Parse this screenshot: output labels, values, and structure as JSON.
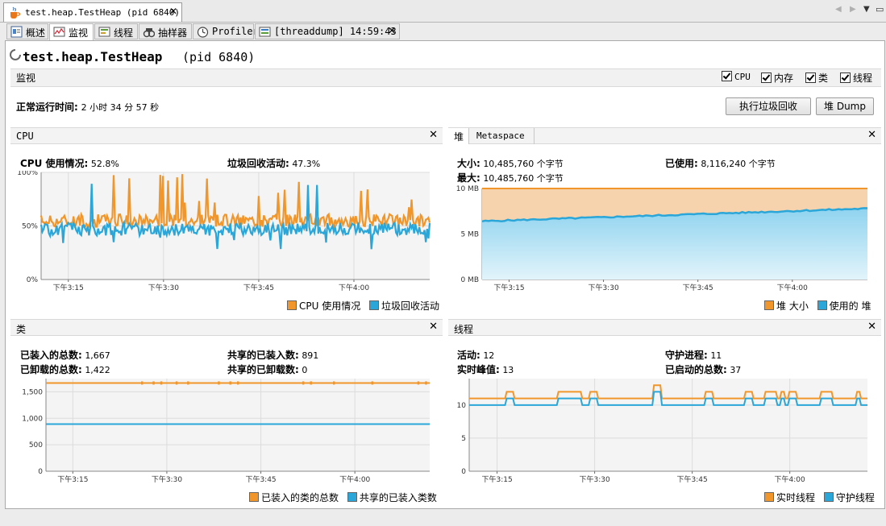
{
  "window": {
    "tab_title": "test.heap.TestHeap (pid 6840)"
  },
  "subtabs": [
    {
      "label": "概述",
      "icon": "overview-icon"
    },
    {
      "label": "监视",
      "icon": "monitor-icon"
    },
    {
      "label": "线程",
      "icon": "threads-icon"
    },
    {
      "label": "抽样器",
      "icon": "sampler-icon"
    },
    {
      "label": "Profiler",
      "icon": "profiler-icon"
    },
    {
      "label": "[threaddump] 14:59:43",
      "icon": "threaddump-icon"
    }
  ],
  "app": {
    "name": "test.heap.TestHeap",
    "pid": "(pid 6840)"
  },
  "monitor": {
    "label": "监视",
    "checkboxes": [
      {
        "label": "CPU",
        "checked": true
      },
      {
        "label": "内存",
        "checked": true
      },
      {
        "label": "类",
        "checked": true
      },
      {
        "label": "线程",
        "checked": true
      }
    ],
    "uptime_label": "正常运行时间:",
    "uptime_value": "2 小时 34 分 57 秒",
    "gc_button": "执行垃圾回收",
    "heapdump_button": "堆 Dump"
  },
  "cpu": {
    "title": "CPU",
    "usage_label": "CPU 使用情况:",
    "usage_value": "52.8%",
    "gc_label": "垃圾回收活动:",
    "gc_value": "47.3%",
    "legend": [
      "CPU 使用情况",
      "垃圾回收活动"
    ]
  },
  "heap": {
    "tabs": [
      "堆",
      "Metaspace"
    ],
    "size_label": "大小:",
    "size_value": "10,485,760 个字节",
    "max_label": "最大:",
    "max_value": "10,485,760 个字节",
    "used_label": "已使用:",
    "used_value": "8,116,240 个字节",
    "legend": [
      "堆 大小",
      "使用的 堆"
    ]
  },
  "classes": {
    "title": "类",
    "loaded_label": "已装入的总数:",
    "loaded_value": "1,667",
    "unloaded_label": "已卸载的总数:",
    "unloaded_value": "1,422",
    "shared_loaded_label": "共享的已装入数:",
    "shared_loaded_value": "891",
    "shared_unloaded_label": "共享的已卸载数:",
    "shared_unloaded_value": "0",
    "legend": [
      "已装入的类的总数",
      "共享的已装入类数"
    ]
  },
  "threads": {
    "title": "线程",
    "live_label": "活动:",
    "live_value": "12",
    "peak_label": "实时峰值:",
    "peak_value": "13",
    "daemon_label": "守护进程:",
    "daemon_value": "11",
    "started_label": "已启动的总数:",
    "started_value": "37",
    "legend": [
      "实时线程",
      "守护线程"
    ]
  },
  "colors": {
    "orange": "#f0962a",
    "blue": "#2aa7d8"
  },
  "chart_data": [
    {
      "type": "line",
      "name": "CPU",
      "x_ticks": [
        "下午3:15",
        "下午3:30",
        "下午3:45",
        "下午4:00"
      ],
      "y_ticks": [
        "100%",
        "50%",
        "0%"
      ],
      "ylim": [
        0,
        100
      ],
      "series": [
        {
          "name": "CPU 使用情况",
          "color": "#f0962a",
          "mean": 55,
          "approx_range": [
            45,
            100
          ]
        },
        {
          "name": "垃圾回收活动",
          "color": "#2aa7d8",
          "mean": 47,
          "approx_range": [
            22,
            92
          ]
        }
      ],
      "grid": true
    },
    {
      "type": "area",
      "name": "堆",
      "x_ticks": [
        "下午3:15",
        "下午3:30",
        "下午3:45",
        "下午4:00"
      ],
      "y_ticks": [
        "10 MB",
        "5 MB",
        "0 MB"
      ],
      "ylim": [
        0,
        10
      ],
      "series": [
        {
          "name": "堆 大小",
          "color": "#f0962a",
          "start": 10,
          "end": 10
        },
        {
          "name": "使用的 堆",
          "color": "#2aa7d8",
          "start": 6.4,
          "end": 7.8
        }
      ],
      "grid": true
    },
    {
      "type": "line",
      "name": "类",
      "x_ticks": [
        "下午3:15",
        "下午3:30",
        "下午3:45",
        "下午4:00"
      ],
      "y_ticks": [
        "1,500",
        "1,000",
        "500",
        "0"
      ],
      "ylim": [
        0,
        1750
      ],
      "series": [
        {
          "name": "已装入的类的总数",
          "color": "#f0962a",
          "value": 1667
        },
        {
          "name": "共享的已装入类数",
          "color": "#2aa7d8",
          "value": 891
        }
      ],
      "grid": true
    },
    {
      "type": "line",
      "name": "线程",
      "x_ticks": [
        "下午3:15",
        "下午3:30",
        "下午3:45",
        "下午4:00"
      ],
      "y_ticks": [
        "10",
        "5",
        "0"
      ],
      "ylim": [
        0,
        14
      ],
      "series": [
        {
          "name": "实时线程",
          "color": "#f0962a",
          "baseline": 11,
          "peaks": [
            12,
            13
          ]
        },
        {
          "name": "守护线程",
          "color": "#2aa7d8",
          "baseline": 10,
          "peaks": [
            11,
            12
          ]
        }
      ],
      "grid": true
    }
  ]
}
